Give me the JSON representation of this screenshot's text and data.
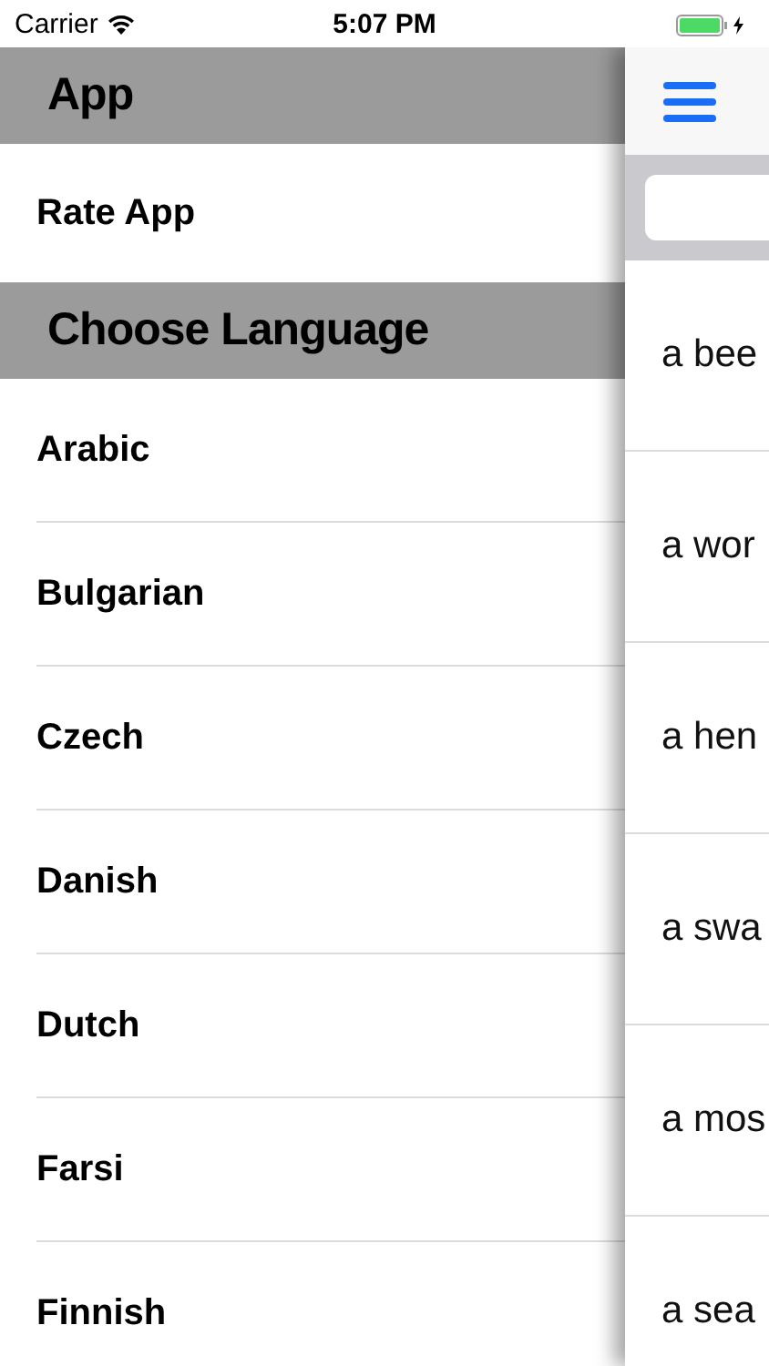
{
  "status_bar": {
    "carrier": "Carrier",
    "time": "5:07 PM"
  },
  "menu": {
    "sections": [
      {
        "title": "App",
        "items": [
          {
            "label": "Rate App"
          }
        ]
      },
      {
        "title": "Choose Language",
        "items": [
          {
            "label": "Arabic"
          },
          {
            "label": "Bulgarian"
          },
          {
            "label": "Czech"
          },
          {
            "label": "Danish"
          },
          {
            "label": "Dutch"
          },
          {
            "label": "Farsi"
          },
          {
            "label": "Finnish"
          }
        ]
      }
    ]
  },
  "content": {
    "rows": [
      {
        "text": "a bee"
      },
      {
        "text": "a wor"
      },
      {
        "text": "a hen"
      },
      {
        "text": "a swa"
      },
      {
        "text": "a mos"
      },
      {
        "text": "a sea"
      }
    ]
  }
}
